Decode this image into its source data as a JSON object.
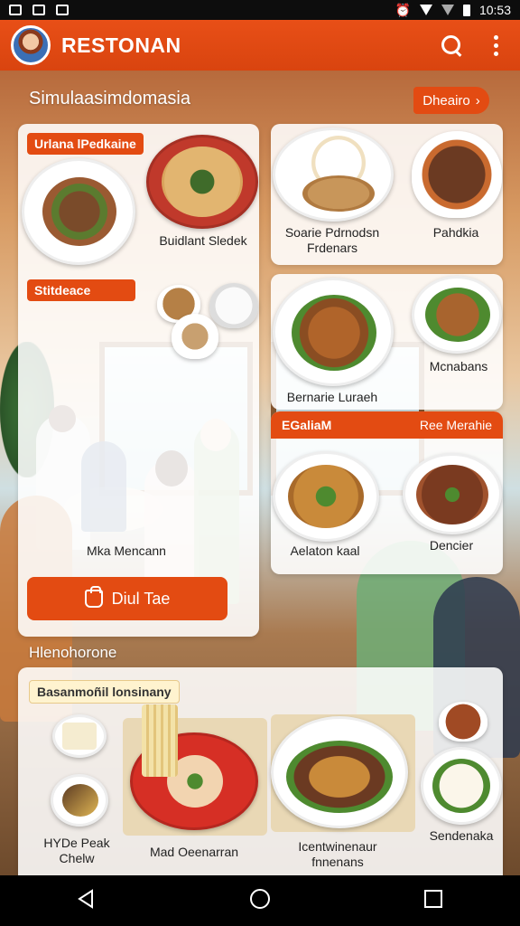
{
  "status_bar": {
    "time": "10:53"
  },
  "app_bar": {
    "title": "RESTONAN",
    "search_icon": "search-icon",
    "menu_icon": "more-vert-icon"
  },
  "section": {
    "title": "Simulaasimdomasia",
    "button_label": "Dheairo"
  },
  "card_left": {
    "tag": "Urlana lPedkaine",
    "dish_label": "Buidlant Sledek",
    "tag2": "Stitdeace",
    "people_label": "Mka Mencann",
    "order_button": "Diul Tae"
  },
  "card_right_top": {
    "label1": "Soarie Pdrnodsn\nFrdenars",
    "label2": "Pahdkia"
  },
  "card_right_mid": {
    "label1": "Bernarie Luraeh",
    "label2": "Mcnabans"
  },
  "card_right_bottom": {
    "tag_left": "EGaliaM",
    "tag_right": "Ree Merahie",
    "label1": "Aelaton kaal",
    "label2": "Dencier"
  },
  "section2": {
    "title": "Hlenohorone"
  },
  "bottom_card": {
    "tag": "Basanmoñil lonsinany",
    "label1": "HYDe Peak\nChelw",
    "label2": "Mad Oeenarran",
    "label3": "Icentwinenaur\nfnnenans",
    "label4": "Sendenaka"
  },
  "colors": {
    "accent": "#e34b12",
    "appbar": "#e04a13"
  }
}
